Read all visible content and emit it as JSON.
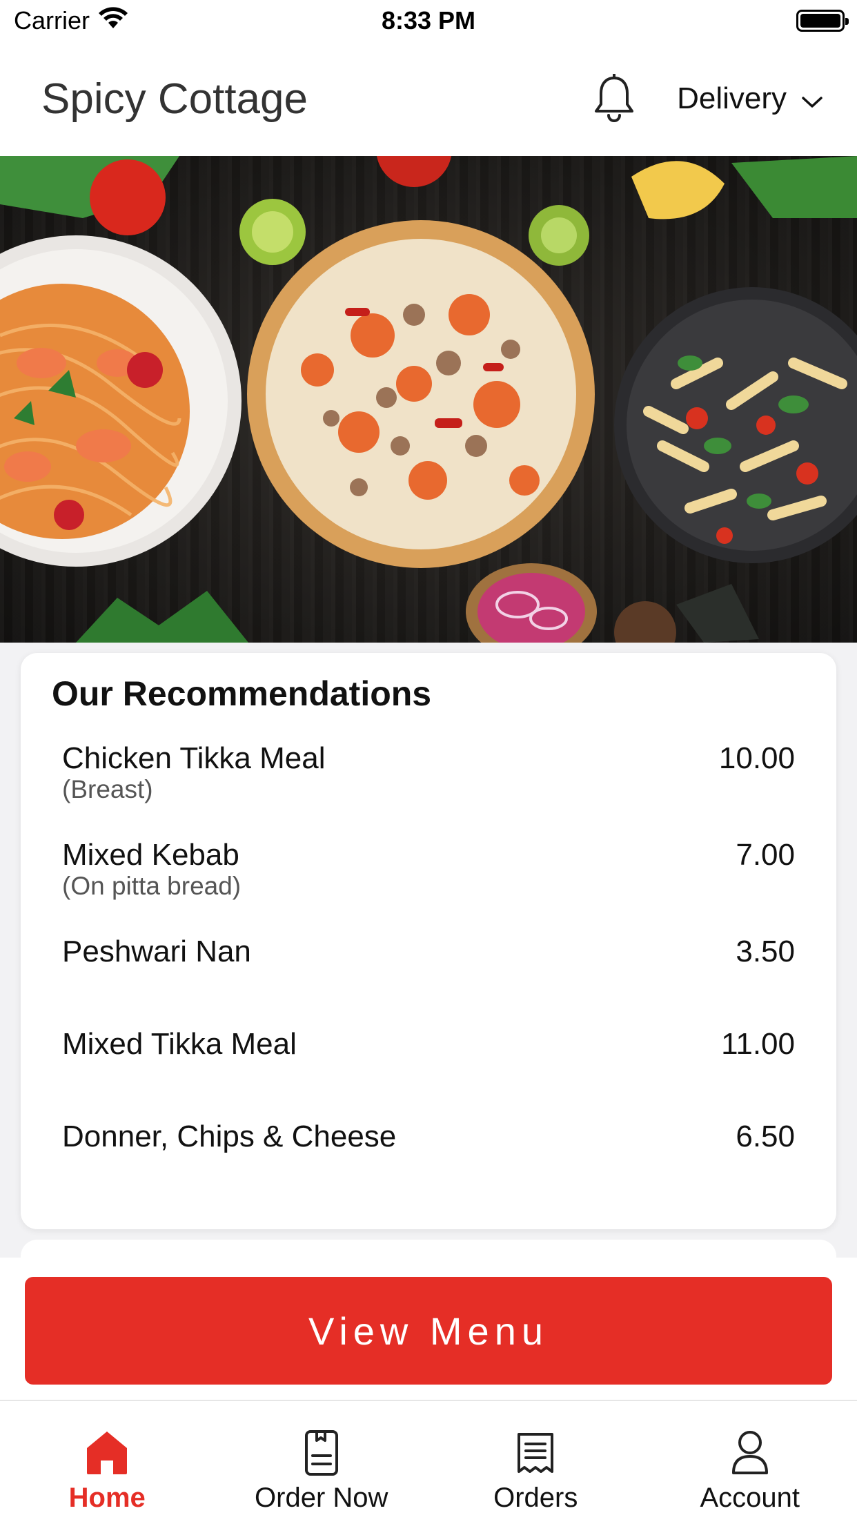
{
  "status_bar": {
    "carrier": "Carrier",
    "time": "8:33 PM"
  },
  "header": {
    "title": "Spicy Cottage",
    "delivery_label": "Delivery"
  },
  "recommendations": {
    "title": "Our Recommendations",
    "items": [
      {
        "name": "Chicken Tikka Meal",
        "sub": "(Breast)",
        "price": "10.00"
      },
      {
        "name": "Mixed Kebab",
        "sub": "(On pitta bread)",
        "price": "7.00"
      },
      {
        "name": "Peshwari Nan",
        "sub": "",
        "price": "3.50"
      },
      {
        "name": "Mixed Tikka Meal",
        "sub": "",
        "price": "11.00"
      },
      {
        "name": "Donner, Chips & Cheese",
        "sub": "",
        "price": "6.50"
      }
    ]
  },
  "actions": {
    "view_menu": "View Menu"
  },
  "tabs": [
    {
      "label": "Home",
      "icon": "home-icon",
      "active": true
    },
    {
      "label": "Order Now",
      "icon": "order-icon",
      "active": false
    },
    {
      "label": "Orders",
      "icon": "receipt-icon",
      "active": false
    },
    {
      "label": "Account",
      "icon": "user-icon",
      "active": false
    }
  ],
  "colors": {
    "accent": "#e52e26",
    "card": "#ffffff",
    "background": "#f2f2f4"
  }
}
